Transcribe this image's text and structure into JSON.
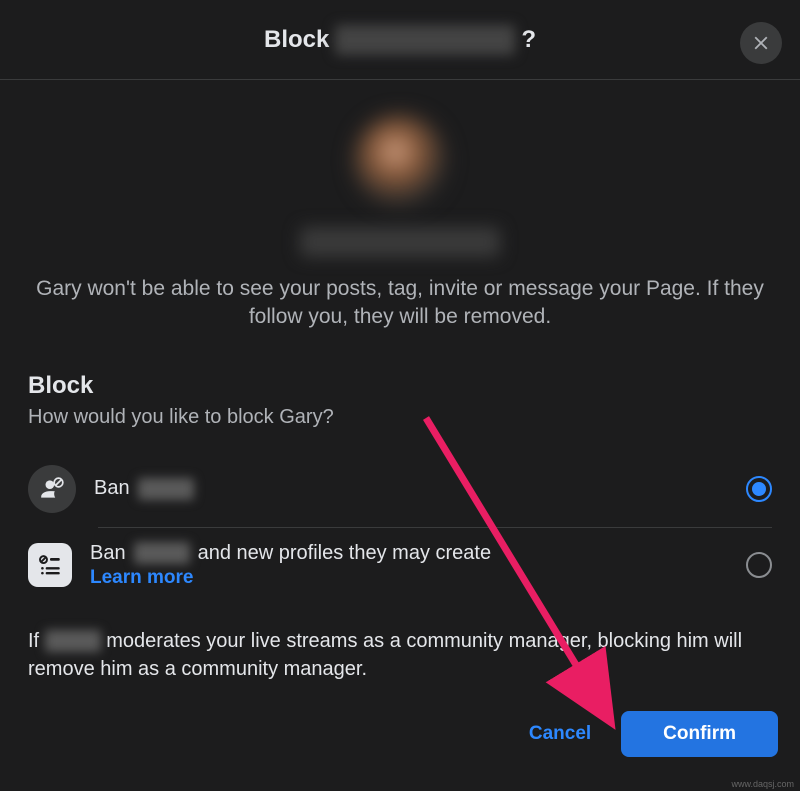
{
  "header": {
    "title_prefix": "Block",
    "title_suffix": "?",
    "close_label": "Close"
  },
  "profile": {
    "description": "Gary won't be able to see your posts, tag, invite or message your Page. If they follow you, they will be removed."
  },
  "block": {
    "heading": "Block",
    "subheading": "How would you like to block Gary?",
    "options": [
      {
        "prefix": "Ban",
        "suffix": "",
        "learn_more": "",
        "selected": true
      },
      {
        "prefix": "Ban",
        "suffix": "and new profiles they may create",
        "learn_more": "Learn more",
        "selected": false
      }
    ]
  },
  "footer": {
    "note_prefix": "If",
    "note_suffix": "moderates your live streams as a community manager, blocking him will remove him as a community manager."
  },
  "actions": {
    "cancel": "Cancel",
    "confirm": "Confirm"
  },
  "watermark": "www.daqsj.com"
}
